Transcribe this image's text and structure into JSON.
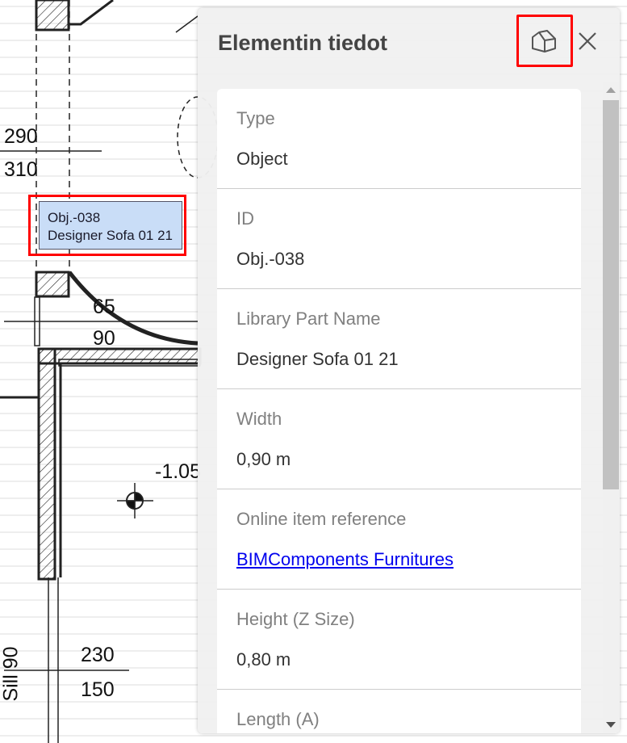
{
  "plan": {
    "dimensions": [
      "290",
      "310",
      "65",
      "90",
      "-1.05",
      "230",
      "150",
      "Sill 90"
    ],
    "selected_tag": {
      "line1": "Obj.-038",
      "line2": "Designer Sofa 01 21"
    }
  },
  "panel": {
    "title": "Elementin tiedot",
    "icons": {
      "view3d": "cube-3d-icon",
      "close": "close-icon"
    },
    "properties": [
      {
        "label": "Type",
        "value": "Object"
      },
      {
        "label": "ID",
        "value": "Obj.-038"
      },
      {
        "label": "Library Part Name",
        "value": "Designer Sofa 01 21"
      },
      {
        "label": "Width",
        "value": "0,90 m"
      },
      {
        "label": "Online item reference",
        "value": "BIMComponents Furnitures",
        "link": true
      },
      {
        "label": "Height (Z Size)",
        "value": "0,80 m"
      },
      {
        "label": "Length (A)",
        "value": ""
      }
    ]
  }
}
